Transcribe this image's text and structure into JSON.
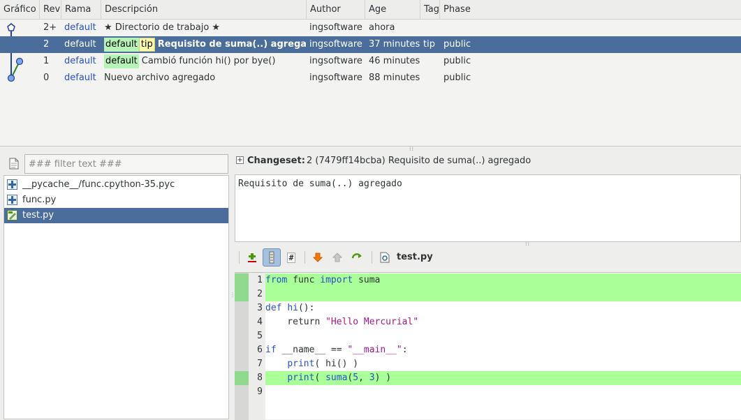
{
  "revlog": {
    "columns": [
      "Gráfico",
      "Rev",
      "Rama",
      "Descripción",
      "Author",
      "Age",
      "Tag",
      "Phase"
    ],
    "rows": [
      {
        "rev": "2+",
        "branch": "default",
        "tags": [],
        "desc": "★ Directorio de trabajo ★",
        "author": "ingsoftware",
        "age": "ahora",
        "tag": "",
        "phase": ""
      },
      {
        "rev": "2",
        "branch": "default",
        "tags": [
          {
            "label": "default",
            "kind": "green"
          },
          {
            "label": "tip",
            "kind": "yellow"
          }
        ],
        "desc": "Requisito de suma(..) agregado",
        "author": "ingsoftware",
        "age": "37 minutes",
        "tag": "tip",
        "phase": "public",
        "selected": true
      },
      {
        "rev": "1",
        "branch": "default",
        "tags": [
          {
            "label": "default",
            "kind": "green"
          }
        ],
        "desc": "Cambió función hi() por bye()",
        "author": "ingsoftware",
        "age": "46 minutes",
        "tag": "",
        "phase": "public"
      },
      {
        "rev": "0",
        "branch": "default",
        "tags": [],
        "desc": "Nuevo archivo agregado",
        "author": "ingsoftware",
        "age": "88 minutes",
        "tag": "",
        "phase": "public"
      }
    ]
  },
  "filter": {
    "placeholder": "### filter text ###"
  },
  "files": [
    {
      "name": "__pycache__/func.cpython-35.pyc",
      "icon": "file-added-icon"
    },
    {
      "name": "func.py",
      "icon": "file-added-icon"
    },
    {
      "name": "test.py",
      "icon": "file-modified-icon",
      "selected": true
    }
  ],
  "changeset": {
    "label": "Changeset:",
    "value": "2 (7479ff14bcba) Requisito de suma(..) agregado",
    "message": "Requisito de suma(..) agregado"
  },
  "toolbar": {
    "filename": "test.py",
    "icons": [
      "annotate-icon",
      "diff-mode-icon",
      "line-numbers-icon",
      "next-diff-icon",
      "prev-diff-icon",
      "rotate-icon",
      "file-view-icon"
    ]
  },
  "code_lines": [
    {
      "n": "1",
      "added": true
    },
    {
      "n": "2",
      "added": true
    },
    {
      "n": "3",
      "added": false
    },
    {
      "n": "4",
      "added": false
    },
    {
      "n": "5",
      "added": false
    },
    {
      "n": "6",
      "added": false
    },
    {
      "n": "7",
      "added": false
    },
    {
      "n": "8",
      "added": true
    },
    {
      "n": "9",
      "added": false
    }
  ],
  "code_tokens": {
    "l1": [
      "from",
      " func ",
      "import",
      " suma"
    ],
    "l3": [
      "def",
      " ",
      "hi",
      "():"
    ],
    "l4": [
      "    return ",
      "\"Hello Mercurial\""
    ],
    "l6": [
      "if",
      " __name__ == ",
      "\"__main__\"",
      ":"
    ],
    "l7": [
      "    ",
      "print",
      "( hi() )"
    ],
    "l8": [
      "    ",
      "print",
      "( ",
      "suma",
      "(",
      "5",
      ", ",
      "3",
      ") )"
    ]
  },
  "colors": {
    "selection": "#4a6d9c",
    "added_line": "#aaff99",
    "branch_link": "#2a4fc9"
  }
}
